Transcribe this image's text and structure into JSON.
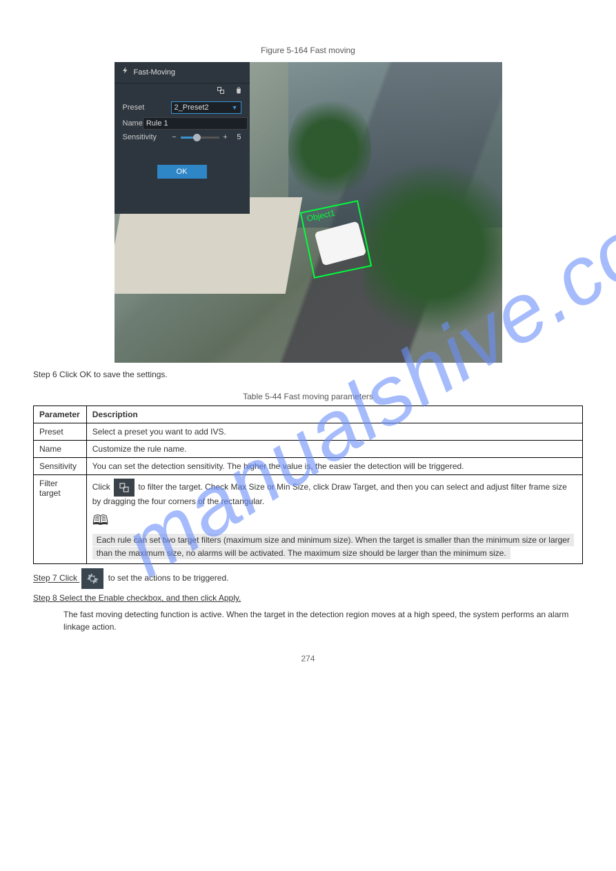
{
  "figure": {
    "caption": "Figure 5-164 Fast moving",
    "panel": {
      "title": "Fast-Moving",
      "preset_label": "Preset",
      "preset_value": "2_Preset2",
      "name_label": "Name",
      "name_value": "Rule 1",
      "sensitivity_label": "Sensitivity",
      "sensitivity_value": "5",
      "ok_label": "OK"
    },
    "detection_label": "Object1"
  },
  "para1": "Step 6   Click OK to save the settings.",
  "table": {
    "caption": "Table 5-44 Fast moving parameters",
    "headers": [
      "Parameter",
      "Description"
    ],
    "rows": [
      {
        "p": "Preset",
        "d": "Select a preset you want to add IVS."
      },
      {
        "p": "Name",
        "d": "Customize the rule name."
      },
      {
        "p": "Sensitivity",
        "d": "You can set the detection sensitivity. The higher the value is, the easier the detection will be triggered."
      },
      {
        "p": "Filter target",
        "d_intro": "Click ",
        "d_after_icon": " to filter the target. Check Max Size or Min Size, click Draw Target, and then you can select and adjust filter frame size by dragging the four corners of the rectangular.",
        "note1": "Each rule can set two target filters (maximum size and minimum size). When the target is smaller than the minimum size or larger than the maximum size, no alarms will be activated. The maximum size should be larger than the minimum size."
      }
    ]
  },
  "step7": {
    "prefix": "Step 7   Click ",
    "mid": " to set the actions to be triggered.",
    "after": "Step 8   Select the Enable checkbox, and then click Apply.",
    "desc": "The fast moving detecting function is active. When the target in the detection region moves at a high speed, the system performs an alarm linkage action."
  },
  "page_number": "274"
}
